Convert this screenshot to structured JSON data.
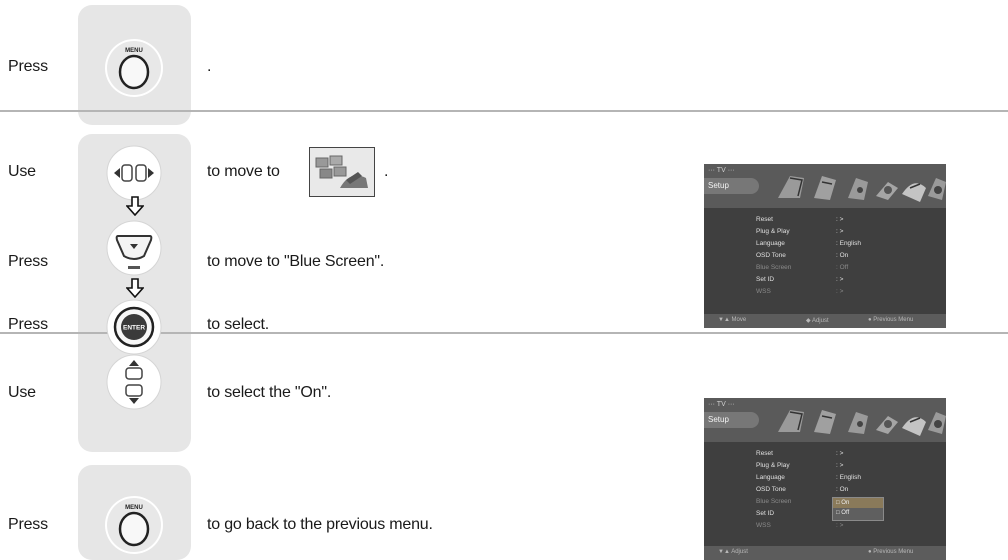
{
  "steps": [
    {
      "verb": "Press",
      "text": "."
    },
    {
      "verb": "Use",
      "text": "to move to",
      "after": "."
    },
    {
      "verb": "Press",
      "text": "to move to \"Blue Screen\"."
    },
    {
      "verb": "Press",
      "text": "to select."
    },
    {
      "verb": "Use",
      "text": "to select the \"On\"."
    },
    {
      "verb": "Press",
      "text": "to go back to the previous menu."
    }
  ],
  "buttons": {
    "menu_label": "MENU",
    "enter_label": "ENTER"
  },
  "screen1": {
    "title": "··· TV ···",
    "tab": "Setup",
    "rows": [
      {
        "label": "Reset",
        "value": ": >"
      },
      {
        "label": "Plug & Play",
        "value": ": >"
      },
      {
        "label": "Language",
        "value": ": English"
      },
      {
        "label": "OSD Tone",
        "value": ": On"
      },
      {
        "label": "Blue Screen",
        "value": ": Off"
      },
      {
        "label": "Set ID",
        "value": ": >"
      },
      {
        "label": "WSS",
        "value": ": >"
      }
    ],
    "footer": {
      "move": "▼▲ Move",
      "adjust": "◆ Adjust",
      "previous": "● Previous Menu"
    }
  },
  "screen2": {
    "title": "··· TV ···",
    "tab": "Setup",
    "rows": [
      {
        "label": "Reset",
        "value": ": >"
      },
      {
        "label": "Plug & Play",
        "value": ": >"
      },
      {
        "label": "Language",
        "value": ": English"
      },
      {
        "label": "OSD Tone",
        "value": ": On"
      },
      {
        "label": "Blue Screen",
        "value": ""
      },
      {
        "label": "Set ID",
        "value": ""
      },
      {
        "label": "WSS",
        "value": ": >"
      }
    ],
    "popup": [
      "□ On",
      "□ Off"
    ],
    "footer": {
      "adjust": "▼▲ Adjust",
      "previous": "● Previous Menu"
    }
  }
}
